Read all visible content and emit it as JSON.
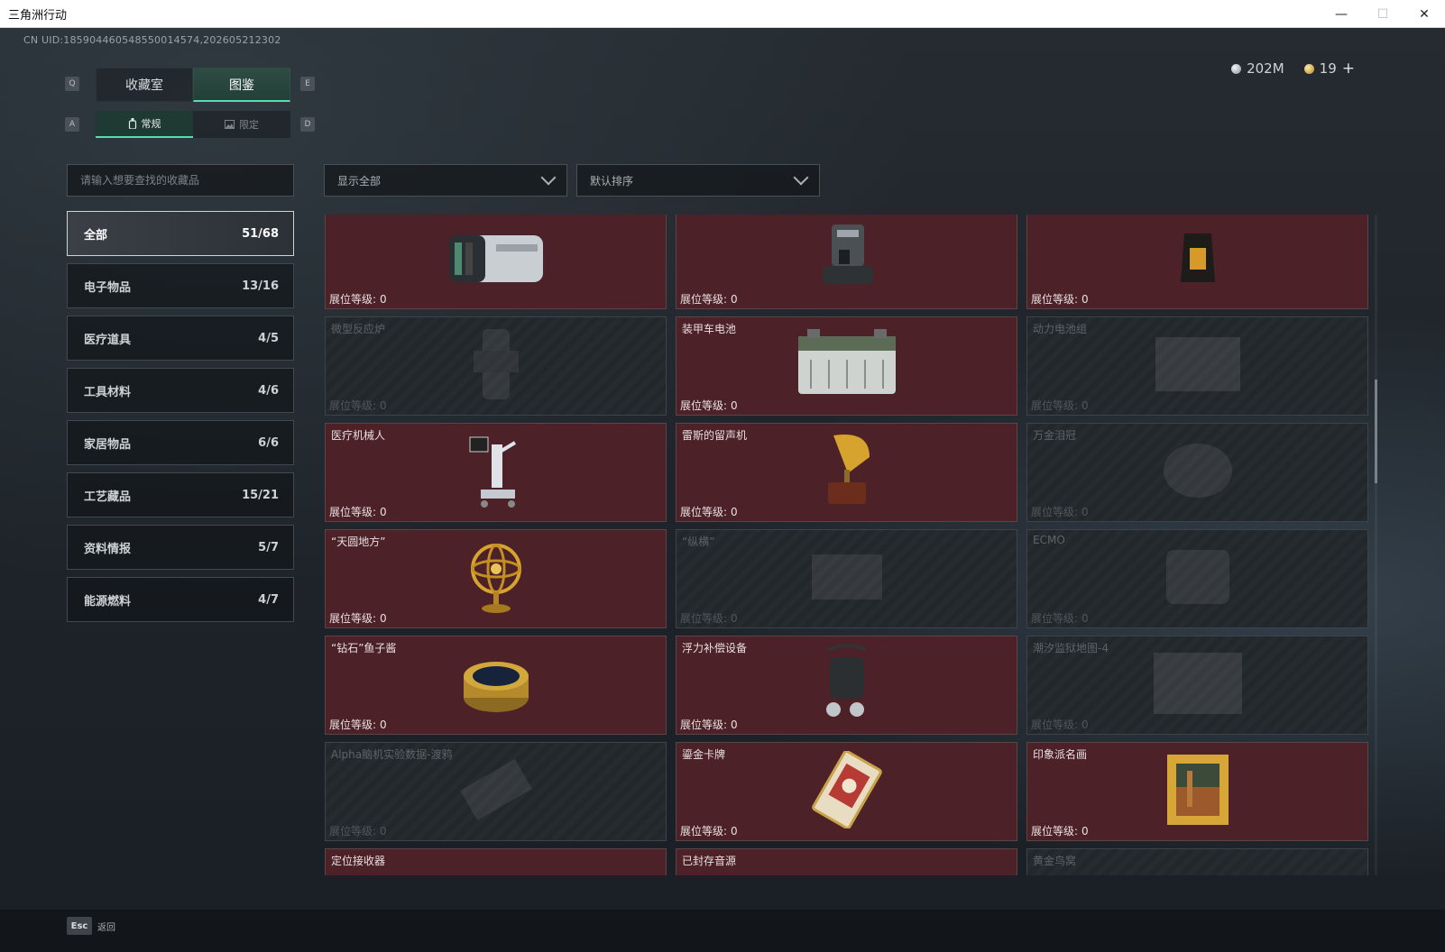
{
  "window": {
    "title": "三角洲行动",
    "minimize": "—",
    "maximize": "☐",
    "close": "✕"
  },
  "uid": "CN UID:185904460548550014574,202605212302",
  "currency": {
    "silver": "202M",
    "gold": "19",
    "plus": "+"
  },
  "keys": {
    "q": "Q",
    "e": "E",
    "a": "A",
    "d": "D"
  },
  "tabs": [
    "收藏室",
    "图鉴"
  ],
  "subtabs": [
    "常规",
    "限定"
  ],
  "search": {
    "placeholder": "请输入想要查找的收藏品"
  },
  "filters": {
    "show": "显示全部",
    "sort": "默认排序"
  },
  "categories": [
    {
      "label": "全部",
      "count": "51/68"
    },
    {
      "label": "电子物品",
      "count": "13/16"
    },
    {
      "label": "医疗道具",
      "count": "4/5"
    },
    {
      "label": "工具材料",
      "count": "4/6"
    },
    {
      "label": "家居物品",
      "count": "6/6"
    },
    {
      "label": "工艺藏品",
      "count": "15/21"
    },
    {
      "label": "资料情报",
      "count": "5/7"
    },
    {
      "label": "能源燃料",
      "count": "4/7"
    }
  ],
  "level_label": "展位等级:",
  "items": [
    {
      "name": "",
      "level": "0",
      "locked": false,
      "icon": "camera-icon"
    },
    {
      "name": "",
      "level": "0",
      "locked": false,
      "icon": "coffee-machine-icon"
    },
    {
      "name": "",
      "level": "0",
      "locked": false,
      "icon": "coffee-bag-icon"
    },
    {
      "name": "微型反应炉",
      "level": "0",
      "locked": true,
      "icon": "reactor-icon"
    },
    {
      "name": "装甲车电池",
      "level": "0",
      "locked": false,
      "icon": "battery-icon"
    },
    {
      "name": "动力电池组",
      "level": "0",
      "locked": true,
      "icon": "battery-pack-icon"
    },
    {
      "name": "医疗机械人",
      "level": "0",
      "locked": false,
      "icon": "medical-robot-icon"
    },
    {
      "name": "雷斯的留声机",
      "level": "0",
      "locked": false,
      "icon": "gramophone-icon"
    },
    {
      "name": "万金泪冠",
      "level": "0",
      "locked": true,
      "icon": "crown-icon"
    },
    {
      "name": "“天圆地方”",
      "level": "0",
      "locked": false,
      "icon": "armillary-sphere-icon"
    },
    {
      "name": "“纵横”",
      "level": "0",
      "locked": true,
      "icon": "chessboard-icon"
    },
    {
      "name": "ECMO",
      "level": "0",
      "locked": true,
      "icon": "ecmo-icon"
    },
    {
      "name": "“钻石”鱼子酱",
      "level": "0",
      "locked": false,
      "icon": "caviar-tin-icon"
    },
    {
      "name": "浮力补偿设备",
      "level": "0",
      "locked": false,
      "icon": "buoyancy-device-icon"
    },
    {
      "name": "潮汐监狱地图-4",
      "level": "0",
      "locked": true,
      "icon": "map-icon"
    },
    {
      "name": "Alpha脑机实验数据-渡鸦",
      "level": "0",
      "locked": true,
      "icon": "data-drive-icon"
    },
    {
      "name": "鎏金卡牌",
      "level": "0",
      "locked": false,
      "icon": "gilded-card-icon"
    },
    {
      "name": "印象派名画",
      "level": "0",
      "locked": false,
      "icon": "painting-icon"
    },
    {
      "name": "定位接收器",
      "level": "",
      "locked": false,
      "icon": "locator-icon"
    },
    {
      "name": "已封存音源",
      "level": "",
      "locked": false,
      "icon": "tape-reels-icon"
    },
    {
      "name": "黄金鸟窝",
      "level": "",
      "locked": true,
      "icon": "golden-nest-icon"
    }
  ],
  "footer": {
    "esc_key": "Esc",
    "esc_label": "返回"
  }
}
